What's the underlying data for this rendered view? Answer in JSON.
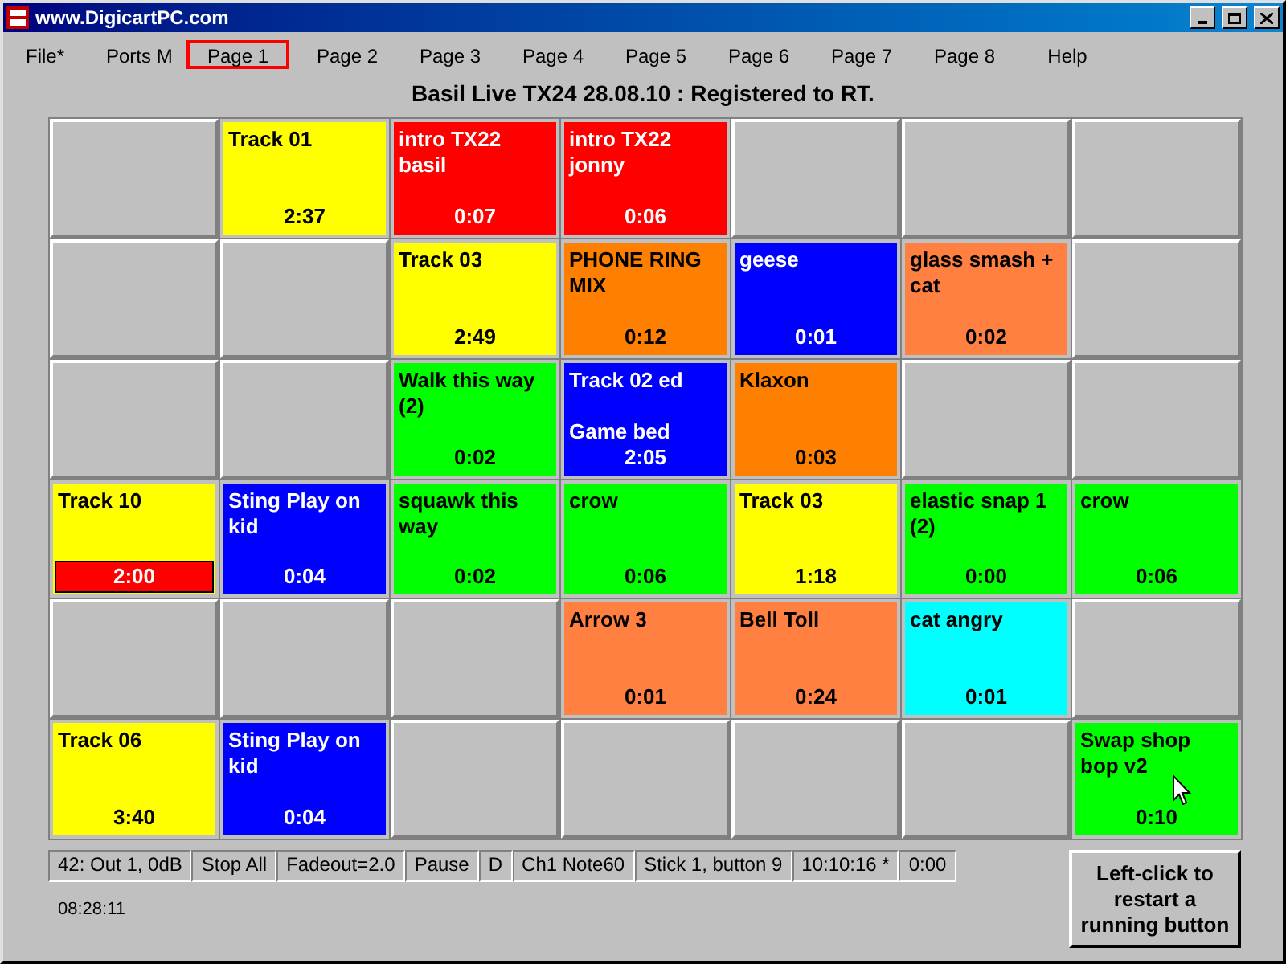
{
  "window": {
    "title": "www.DigicartPC.com"
  },
  "menu": [
    {
      "label": "File*",
      "selected": false
    },
    {
      "label": "Ports M",
      "selected": false
    },
    {
      "label": "Page 1",
      "selected": true
    },
    {
      "label": "Page 2",
      "selected": false
    },
    {
      "label": "Page 3",
      "selected": false
    },
    {
      "label": "Page 4",
      "selected": false
    },
    {
      "label": "Page 5",
      "selected": false
    },
    {
      "label": "Page 6",
      "selected": false
    },
    {
      "label": "Page 7",
      "selected": false
    },
    {
      "label": "Page 8",
      "selected": false
    },
    {
      "label": "Help",
      "selected": false
    }
  ],
  "header": "Basil Live TX24 28.08.10 : Registered to RT.",
  "cells": [
    {
      "kind": "empty"
    },
    {
      "kind": "button",
      "label": "Track 01",
      "time": "2:37",
      "color": "#ffff00",
      "playing": false
    },
    {
      "kind": "button",
      "label": "intro TX22 basil",
      "time": "0:07",
      "color": "#ff0000",
      "playing": false
    },
    {
      "kind": "button",
      "label": "intro TX22 jonny",
      "time": "0:06",
      "color": "#ff0000",
      "playing": false
    },
    {
      "kind": "empty"
    },
    {
      "kind": "empty"
    },
    {
      "kind": "empty"
    },
    {
      "kind": "empty"
    },
    {
      "kind": "empty"
    },
    {
      "kind": "button",
      "label": "Track 03",
      "time": "2:49",
      "color": "#ffff00",
      "playing": false
    },
    {
      "kind": "button",
      "label": "PHONE RING MIX",
      "time": "0:12",
      "color": "#ff8000",
      "playing": false
    },
    {
      "kind": "button",
      "label": "geese",
      "time": "0:01",
      "color": "#0000ff",
      "playing": false
    },
    {
      "kind": "button",
      "label": "glass smash + cat",
      "time": "0:02",
      "color": "#ff8040",
      "playing": false
    },
    {
      "kind": "empty"
    },
    {
      "kind": "empty"
    },
    {
      "kind": "empty"
    },
    {
      "kind": "button",
      "label": "Walk this way (2)",
      "time": "0:02",
      "color": "#00ff00",
      "playing": false
    },
    {
      "kind": "button",
      "label": "Track 02 ed",
      "sublabel": "Game bed",
      "time": "2:05",
      "color": "#0000ff",
      "playing": false
    },
    {
      "kind": "button",
      "label": "Klaxon",
      "time": "0:03",
      "color": "#ff8000",
      "playing": false
    },
    {
      "kind": "empty"
    },
    {
      "kind": "empty"
    },
    {
      "kind": "button",
      "label": "Track 10",
      "time": "2:00",
      "color": "#ffff00",
      "playing": true
    },
    {
      "kind": "button",
      "label": "Sting Play on kid",
      "time": "0:04",
      "color": "#0000ff",
      "playing": false
    },
    {
      "kind": "button",
      "label": "squawk this way",
      "time": "0:02",
      "color": "#00ff00",
      "playing": false
    },
    {
      "kind": "button",
      "label": "crow",
      "time": "0:06",
      "color": "#00ff00",
      "playing": false
    },
    {
      "kind": "button",
      "label": "Track 03",
      "time": "1:18",
      "color": "#ffff00",
      "playing": false
    },
    {
      "kind": "button",
      "label": "elastic snap 1 (2)",
      "time": "0:00",
      "color": "#00ff00",
      "playing": false
    },
    {
      "kind": "button",
      "label": "crow",
      "time": "0:06",
      "color": "#00ff00",
      "playing": false
    },
    {
      "kind": "empty"
    },
    {
      "kind": "empty"
    },
    {
      "kind": "empty"
    },
    {
      "kind": "button",
      "label": "Arrow 3",
      "time": "0:01",
      "color": "#ff8040",
      "playing": false
    },
    {
      "kind": "button",
      "label": "Bell Toll",
      "time": "0:24",
      "color": "#ff8040",
      "playing": false
    },
    {
      "kind": "button",
      "label": "cat angry",
      "time": "0:01",
      "color": "#00ffff",
      "playing": false
    },
    {
      "kind": "empty"
    },
    {
      "kind": "button",
      "label": "Track 06",
      "time": "3:40",
      "color": "#ffff00",
      "playing": false
    },
    {
      "kind": "button",
      "label": "Sting Play on kid",
      "time": "0:04",
      "color": "#0000ff",
      "playing": false
    },
    {
      "kind": "empty"
    },
    {
      "kind": "empty"
    },
    {
      "kind": "empty"
    },
    {
      "kind": "empty"
    },
    {
      "kind": "button",
      "label": "Swap shop bop v2",
      "time": "0:10",
      "color": "#00ff00",
      "playing": false
    }
  ],
  "status_bar": [
    "42: Out 1, 0dB",
    "Stop All",
    "Fadeout=2.0",
    "Pause",
    "D",
    "Ch1 Note60",
    "Stick 1, button 9",
    "10:10:16 *",
    "0:00"
  ],
  "clock": "08:28:11",
  "restart_button": "Left-click to restart a running button"
}
